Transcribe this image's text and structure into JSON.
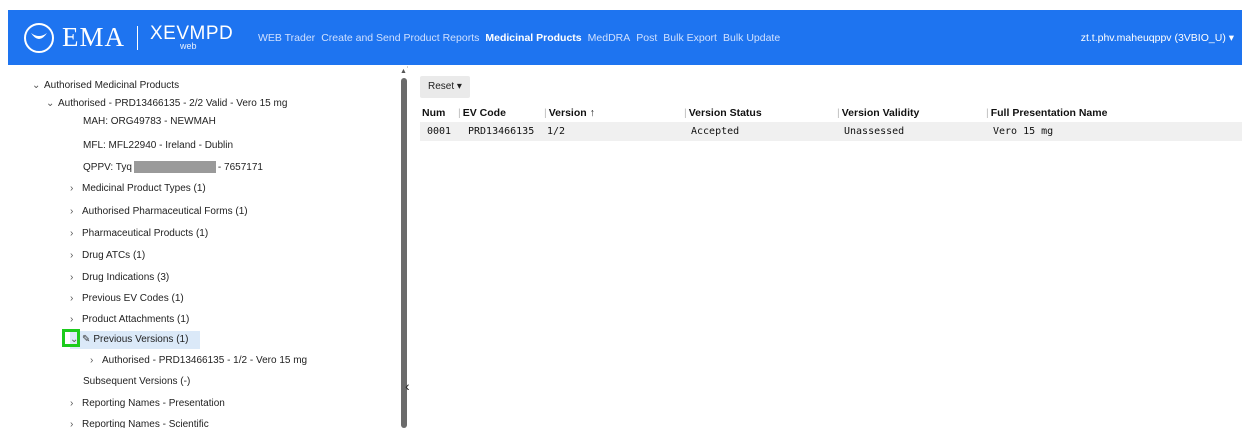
{
  "header": {
    "logo": "EMA",
    "app_name": "XEVMPD",
    "app_sub": "web",
    "nav": [
      "WEB Trader",
      "Create and Send Product Reports",
      "Medicinal Products",
      "MedDRA",
      "Post",
      "Bulk Export",
      "Bulk Update"
    ],
    "nav_active": "Medicinal Products",
    "user": "zt.t.phv.maheuqppv (3VBIO_U) ▾"
  },
  "tree": {
    "root": "Authorised Medicinal Products",
    "product": "Authorised - PRD13466135 - 2/2 Valid - Vero 15 mg",
    "mah": "MAH: ORG49783 - NEWMAH",
    "mfl": "MFL: MFL22940 - Ireland - Dublin",
    "qppv_prefix": "QPPV: Tyq",
    "qppv_suffix": "- 7657171",
    "items": [
      "Medicinal Product Types (1)",
      "Authorised Pharmaceutical Forms (1)",
      "Pharmaceutical Products (1)",
      "Drug ATCs (1)",
      "Drug Indications (3)",
      "Previous EV Codes (1)",
      "Product Attachments (1)"
    ],
    "previous_versions": "Previous Versions (1)",
    "previous_child": "Authorised - PRD13466135 - 1/2 - Vero 15 mg",
    "subsequent": "Subsequent Versions (-)",
    "reporting_presentation": "Reporting Names - Presentation",
    "reporting_scientific": "Reporting Names - Scientific"
  },
  "grid": {
    "reset_label": "Reset ▾",
    "columns": [
      "Num",
      "EV Code",
      "Version ↑",
      "Version Status",
      "Version Validity",
      "Full Presentation Name"
    ],
    "rows": [
      [
        "0001",
        "PRD13466135",
        "1/2",
        "Accepted",
        "Unassessed",
        "Vero 15 mg"
      ]
    ]
  },
  "colors": {
    "header_bg": "#1e74f0",
    "highlight": "#1ccb1c",
    "selected_row": "#dbe9f8"
  }
}
